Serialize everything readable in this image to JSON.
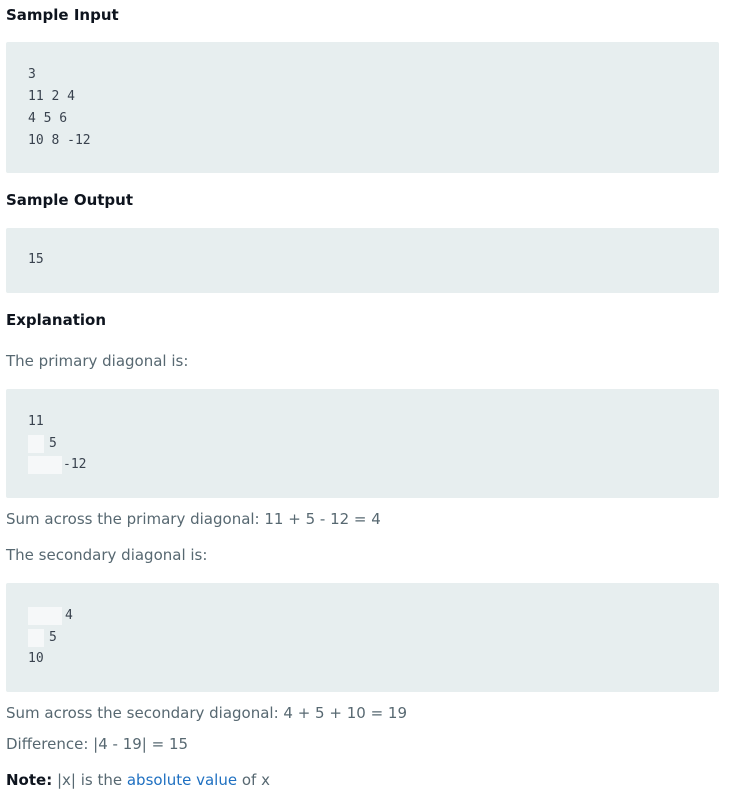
{
  "sample_input": {
    "heading": "Sample Input",
    "lines": [
      "3",
      "11 2 4",
      "4 5 6",
      "10 8 -12"
    ]
  },
  "sample_output": {
    "heading": "Sample Output",
    "lines": [
      "15"
    ]
  },
  "explanation": {
    "heading": "Explanation",
    "primary_intro": "The primary diagonal is:",
    "primary_lines": [
      "11",
      "5",
      "-12"
    ],
    "primary_sum": "Sum across the primary diagonal: 11 + 5 - 12 = 4",
    "secondary_intro": "The secondary diagonal is:",
    "secondary_lines": [
      "4",
      "5",
      "10"
    ],
    "secondary_sum": "Sum across the secondary diagonal: 4 + 5 + 10 = 19",
    "difference": "Difference: |4 - 19| = 15",
    "note_label": "Note:",
    "note_pre": " |x| is the ",
    "note_link": "absolute value",
    "note_post": " of x"
  },
  "colors": {
    "heading": "#0e141e",
    "text": "#576871",
    "code_bg": "#e7eeef",
    "code_highlight": "#f6f8f9",
    "link": "#1f70c1"
  }
}
